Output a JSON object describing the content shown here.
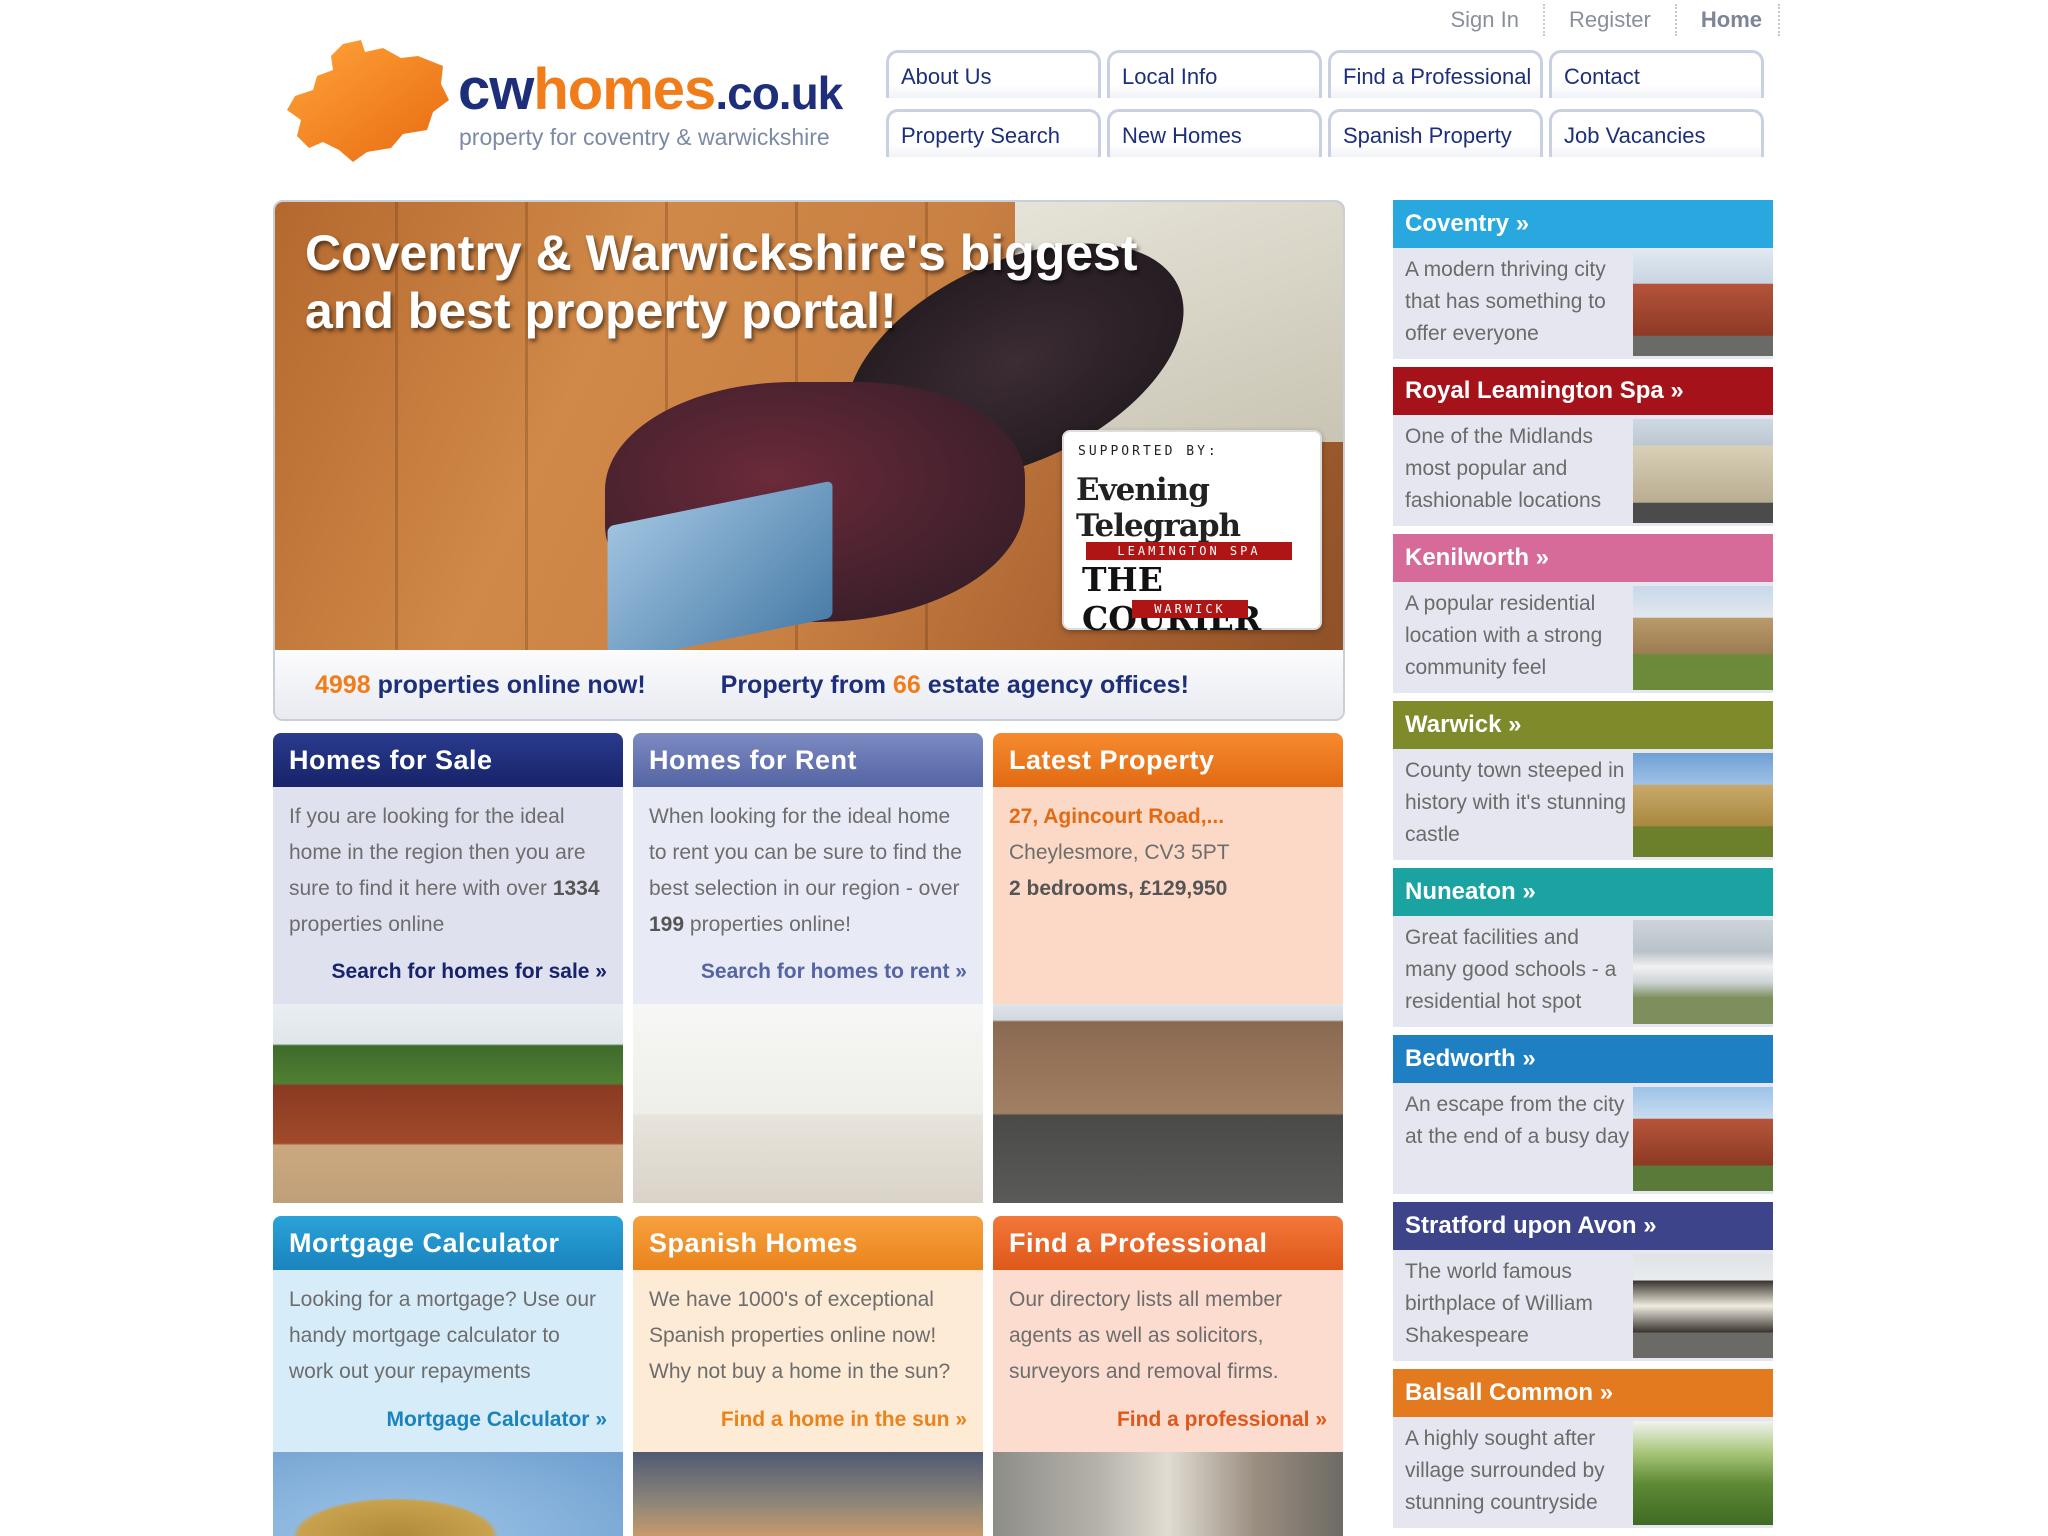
{
  "toplinks": {
    "sign_in": "Sign In",
    "register": "Register",
    "home": "Home"
  },
  "logo": {
    "cw": "cw",
    "homes": "homes",
    "couk": ".co.uk",
    "tagline": "property for coventry & warwickshire"
  },
  "nav": {
    "row1": [
      "About Us",
      "Local Info",
      "Find a Professional",
      "Contact"
    ],
    "row2": [
      "Property Search",
      "New Homes",
      "Spanish Property",
      "Job Vacancies"
    ]
  },
  "hero": {
    "title_line1": "Coventry & Warwickshire's biggest",
    "title_line2": "and best property portal!",
    "supported_by": "SUPPORTED BY:",
    "evening_telegraph": "Evening Telegraph",
    "leamington_spa": "LEAMINGTON SPA",
    "the_courier": "THE COURIER",
    "warwick": "WARWICK",
    "properties_count": "4998",
    "properties_text": "properties online now!",
    "offices_prefix": "Property from",
    "offices_count": "66",
    "offices_text": "estate agency offices!"
  },
  "cards": {
    "sale": {
      "title": "Homes for Sale",
      "text1": "If you are looking for the ideal home in the region then you are sure to find it here with over",
      "count": "1334",
      "text2": "properties online",
      "link": "Search for homes for sale »"
    },
    "rent": {
      "title": "Homes for Rent",
      "text1": "When looking for the ideal home to rent you can be sure to find the best selection in our region - over",
      "count": "199",
      "text2": "properties online!",
      "link": "Search for homes to rent »"
    },
    "latest": {
      "title": "Latest Property",
      "address": "27, Agincourt Road,...",
      "area": "Cheylesmore, CV3 5PT",
      "details": "2 bedrooms, £129,950"
    },
    "mortgage": {
      "title": "Mortgage Calculator",
      "text": "Looking for a mortgage? Use our handy mortgage calculator to work out your repayments",
      "link": "Mortgage Calculator »"
    },
    "spanish": {
      "title": "Spanish Homes",
      "text": "We have 1000's of exceptional Spanish properties online now! Why not buy a home in the sun?",
      "link": "Find a home in the sun »"
    },
    "professional": {
      "title": "Find a Professional",
      "text": "Our directory lists all member agents as well as solicitors, surveyors and removal firms.",
      "link": "Find a professional »"
    }
  },
  "sidebar": [
    {
      "title": "Coventry »",
      "text": "A modern thriving city that has something to offer everyone",
      "color": "#29a8e0"
    },
    {
      "title": "Royal Leamington Spa »",
      "text": "One of the Midlands most popular and fashionable locations",
      "color": "#a5121a"
    },
    {
      "title": "Kenilworth »",
      "text": "A popular residential location with a strong community feel",
      "color": "#d66a98"
    },
    {
      "title": "Warwick »",
      "text": "County town steeped in history with it's stunning castle",
      "color": "#7f8a2a"
    },
    {
      "title": "Nuneaton »",
      "text": "Great facilities and many good schools - a residential hot spot",
      "color": "#1aa3a0"
    },
    {
      "title": "Bedworth »",
      "text": "An escape from the city at the end of a busy day",
      "color": "#1e7fc2"
    },
    {
      "title": "Stratford upon Avon »",
      "text": "The world famous birthplace of William Shakespeare",
      "color": "#3e4489"
    },
    {
      "title": "Balsall Common »",
      "text": "A highly sought after village surrounded by stunning countryside",
      "color": "#e37a1f"
    }
  ]
}
